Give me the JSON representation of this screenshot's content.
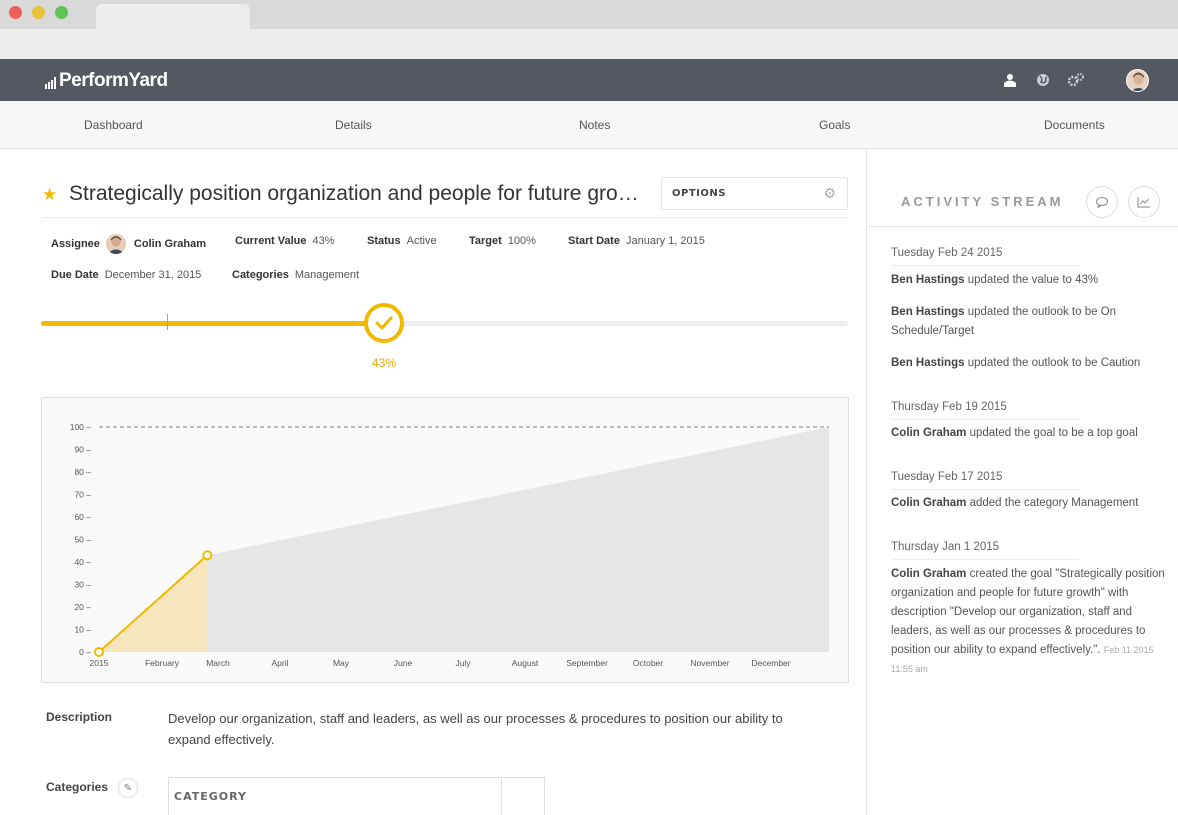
{
  "app": {
    "brand": "PerformYard"
  },
  "nav": {
    "items": [
      "Dashboard",
      "Details",
      "Notes",
      "Goals",
      "Documents"
    ]
  },
  "goal": {
    "title": "Strategically position organization and people for future growth",
    "options_label": "OPTIONS",
    "assignee_label": "Assignee",
    "assignee": "Colin Graham",
    "current_value_label": "Current Value",
    "current_value": "43%",
    "status_label": "Status",
    "status": "Active",
    "target_label": "Target",
    "target": "100%",
    "start_date_label": "Start Date",
    "start_date": "January 1, 2015",
    "due_date_label": "Due Date",
    "due_date": "December 31, 2015",
    "categories_label": "Categories",
    "categories": "Management",
    "progress": 0.43,
    "progress_label": "43%",
    "description_label": "Description",
    "description": "Develop our organization, staff and leaders, as well as our processes & procedures to position our ability to expand effectively.",
    "categories_section_label": "Categories",
    "category_column": "CATEGORY"
  },
  "chart_data": {
    "type": "area",
    "x_ticks": [
      "2015",
      "February",
      "March",
      "April",
      "May",
      "June",
      "July",
      "August",
      "September",
      "October",
      "November",
      "December"
    ],
    "y_ticks": [
      0,
      10,
      20,
      30,
      40,
      50,
      60,
      70,
      80,
      90,
      100
    ],
    "ylim": [
      0,
      100
    ],
    "target": 100,
    "actual": [
      {
        "x": "2015-01-01",
        "y": 0
      },
      {
        "x": "2015-02-24",
        "y": 43
      }
    ],
    "projection": [
      {
        "x": "2015-02-24",
        "y": 43
      },
      {
        "x": "2015-12-31",
        "y": 100
      }
    ],
    "colors": {
      "actual": "#f0b900",
      "actual_fill": "#f7e6bd",
      "projection_fill": "#e6e6e6",
      "target_line": "#999999"
    }
  },
  "stream": {
    "title": "ACTIVITY STREAM",
    "days": [
      {
        "date": "Tuesday Feb 24 2015",
        "entries": [
          {
            "who": "Ben Hastings",
            "text": " updated the value to 43%"
          },
          {
            "who": "Ben Hastings",
            "text": " updated the outlook to be On Schedule/Target"
          },
          {
            "who": "Ben Hastings",
            "text": " updated the outlook to be Caution"
          }
        ]
      },
      {
        "date": "Thursday Feb 19 2015",
        "entries": [
          {
            "who": "Colin Graham",
            "text": " updated the goal to be a top goal"
          }
        ]
      },
      {
        "date": "Tuesday Feb 17 2015",
        "entries": [
          {
            "who": "Colin Graham",
            "text": " added the category Management"
          }
        ]
      },
      {
        "date": "Thursday Jan 1 2015",
        "entries": [
          {
            "who": "Colin Graham",
            "text": " created the goal \"Strategically position organization and people for future growth\" with description \"Develop our organization, staff and leaders, as well as our processes & procedures to position our ability to expand effectively.\".",
            "time": "Feb 11 2015 11:55 am"
          }
        ]
      }
    ]
  },
  "icons": [
    "user-icon",
    "globe-icon",
    "gears-icon",
    "avatar",
    "star-icon",
    "gear-icon",
    "check-icon",
    "comment-icon",
    "chart-icon",
    "pencil-icon"
  ]
}
